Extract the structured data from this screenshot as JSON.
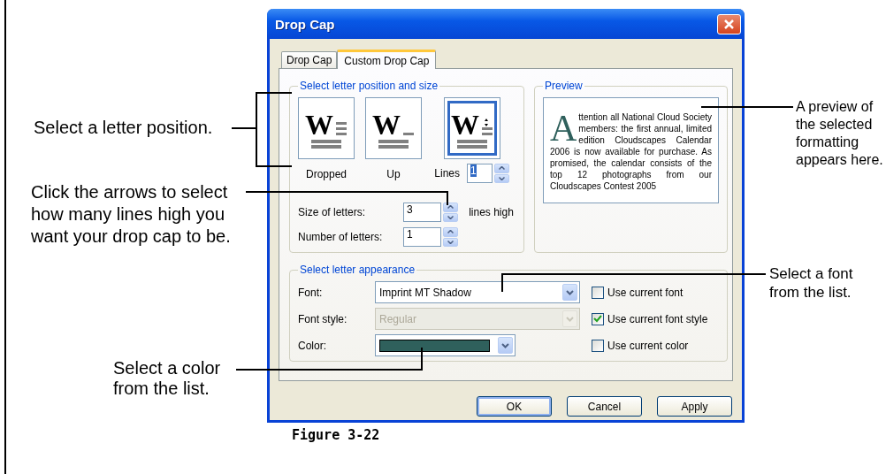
{
  "dialog": {
    "title": "Drop Cap",
    "tabs": [
      {
        "label": "Drop Cap",
        "selected": false
      },
      {
        "label": "Custom Drop Cap",
        "selected": true
      }
    ],
    "position_group": {
      "legend": "Select letter position and size",
      "options": [
        {
          "kind": "dropped",
          "glyph": "W",
          "label": "Dropped",
          "selected": false
        },
        {
          "kind": "up",
          "glyph": "W",
          "label": "Up",
          "selected": false
        },
        {
          "kind": "lines",
          "glyph": "W",
          "label": "Lines",
          "selected": true
        }
      ],
      "lines_value": "1",
      "lines_value_highlighted": true,
      "size_label": "Size of letters:",
      "size_value": "3",
      "size_unit": "lines high",
      "number_label": "Number of letters:",
      "number_value": "1"
    },
    "preview": {
      "legend": "Preview",
      "drop_letter": "A",
      "text": "ttention all National Cloud Society members: the first annual, limited edition Cloudscapes Calendar 2006 is now available for purchase. As promised, the calendar consists of the top 12 photographs from our Cloudscapes Contest 2005"
    },
    "appearance_group": {
      "legend": "Select letter appearance",
      "rows": [
        {
          "kind": "dropdown",
          "label": "Font:",
          "value": "Imprint MT Shadow",
          "disabled": false,
          "checkbox": "Use current font",
          "checked": false
        },
        {
          "kind": "dropdown",
          "label": "Font style:",
          "value": "Regular",
          "disabled": true,
          "checkbox": "Use current font style",
          "checked": true
        },
        {
          "kind": "color",
          "label": "Color:",
          "color": "#2f605c",
          "checkbox": "Use current color",
          "checked": false
        }
      ]
    },
    "buttons": [
      {
        "label": "OK",
        "default": true
      },
      {
        "label": "Cancel",
        "default": false
      },
      {
        "label": "Apply",
        "default": false
      }
    ]
  },
  "callouts": [
    {
      "lines": [
        "Select a letter position."
      ]
    },
    {
      "lines": [
        "A preview of",
        "the selected",
        "formatting",
        "appears here."
      ]
    },
    {
      "lines": [
        "Click the arrows to select",
        "how many lines high you",
        "want your drop cap to be."
      ]
    },
    {
      "lines": [
        "Select a font",
        "from the list."
      ]
    },
    {
      "lines": [
        "Select a color",
        "from the list."
      ]
    }
  ],
  "caption": "Figure 3-22"
}
